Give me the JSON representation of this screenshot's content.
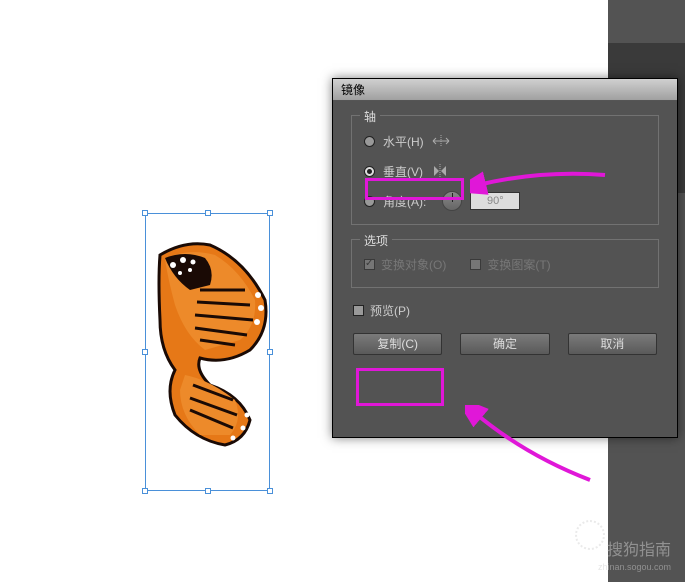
{
  "dialog": {
    "title": "镜像",
    "axis": {
      "legend": "轴",
      "horizontal": "水平(H)",
      "vertical": "垂直(V)",
      "angle": "角度(A):",
      "angle_value": "90°"
    },
    "options": {
      "legend": "选项",
      "transform_objects": "变换对象(O)",
      "transform_pattern": "变换图案(T)"
    },
    "preview": "预览(P)",
    "buttons": {
      "copy": "复制(C)",
      "ok": "确定",
      "cancel": "取消"
    }
  },
  "watermark": {
    "brand": "搜狗指南",
    "url": "zhinan.sogou.com"
  }
}
